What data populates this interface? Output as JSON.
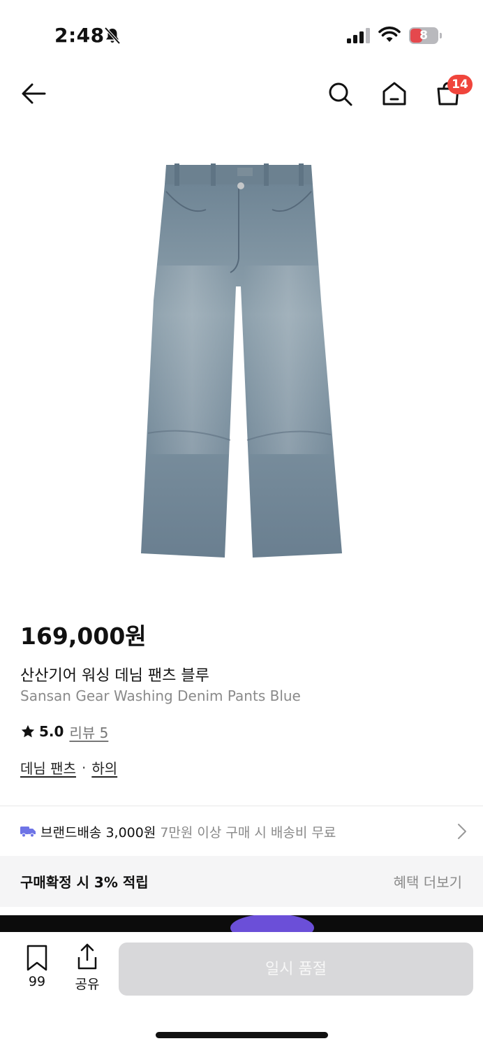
{
  "status_bar": {
    "time": "2:48",
    "battery_level": "8"
  },
  "nav": {
    "cart_count": "14"
  },
  "product": {
    "price": "169,000원",
    "name_ko": "산산기어 워싱 데님 팬츠 블루",
    "name_en": "Sansan Gear Washing Denim Pants Blue",
    "rating": "5.0",
    "review_label": "리뷰 5",
    "category_primary": "데님 팬츠",
    "category_separator": "·",
    "category_secondary": "하의"
  },
  "shipping": {
    "main": "브랜드배송 3,000원",
    "sub": "7만원 이상 구매 시 배송비 무료"
  },
  "benefit": {
    "title": "구매확정 시 3% 적립",
    "more": "혜택 더보기"
  },
  "bottom_bar": {
    "bookmark_count": "99",
    "share_label": "공유",
    "cta_label": "일시 품절"
  },
  "colors": {
    "badge": "#f0453c",
    "truck": "#6e74e6",
    "cta_disabled": "#d8d8da"
  }
}
